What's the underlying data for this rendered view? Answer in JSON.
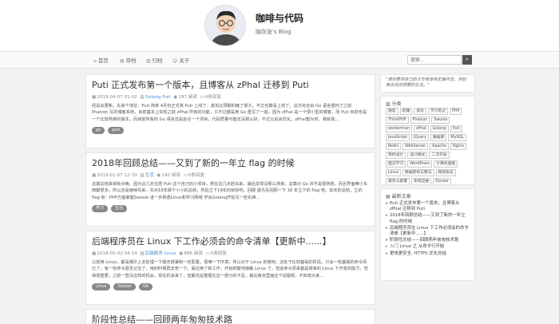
{
  "site": {
    "title": "咖啡与代码",
    "subtitle": "咖灰张's Blog"
  },
  "nav": {
    "items": [
      {
        "icon": "home-icon",
        "glyph": "⌂",
        "label": "首页"
      },
      {
        "icon": "archive-icon",
        "glyph": "▤",
        "label": "存档"
      },
      {
        "icon": "folder-icon",
        "glyph": "▥",
        "label": "归档"
      },
      {
        "icon": "user-icon",
        "glyph": "☺",
        "label": "关于"
      }
    ]
  },
  "search": {
    "placeholder": "搜索...",
    "button_glyph": "⌕"
  },
  "posts": [
    {
      "title": "Puti 正式发布第一个版本，且博客从 zPhal 迁移到 Puti",
      "date": "2019-04-07 01:02",
      "category": "Golang Puti",
      "views": "197 阅读",
      "comments": "0条回复",
      "excerpt": "经是会更新。先来个地址：Puti 简单 4月份正式将 Puti 上线了，其实比预期的晚了很久，不过也算是上线了。这次完全由 Go 语言重构了之前 Phalcon 写的博客系统，目前基本上实现之前 zPhal 所有的功能，只不过都是用 Go 重写了一遍。因为 zPhal 是一个很小型的博客，而 Puti 目前也是一个比较简单的版本，而目前所有的 Go 语言还是处在一个项目，代码质量可能还没那么好，不过以后会优化。zPhal暂为时，我就我...",
      "tags": [
        "go",
        "puti"
      ]
    },
    {
      "title": "2018年回顾总结——又到了新的一年立 flag 的时候",
      "date": "2019-01-07 12:33",
      "category": "生活",
      "views": "190 阅读",
      "comments": "0条回复",
      "excerpt": "这篇总结来得有点晚，因为这几天在把 Puti 这个自己的小项目，想在这几天赶出来，最后发现没那么简单。总算对 Go 并不是很熟悉，而且界面等小东西都很多。所以还是继续先来，先对18年做个小小的总结，然后立下19年的目标吧。回顾 首先先回顾一下 18 年立下的 flag 吧。去年的总结，立的 flag 有：PHP方面掌握Swoole 进一步熟悉Linux和学习网络 学会Golang开始写一些东西...",
      "tags": [
        "学习",
        "生活"
      ]
    },
    {
      "title": "后端程序员在 Linux 下工作必须会的命令清单【更新中......】",
      "date": "2018-05-02 04:14",
      "category": "后端服务 Linux",
      "views": "886 阅读",
      "comments": "0条回复",
      "excerpt": "以前用 Linux，都是偶尔上去处理一下服务部署和一些配置，很难一下环境，所以对于 Linux 的使用，还处于比较基础的阶段。只会一些基础的命令而已了。有一些命令甚至记住了，用的时候再去查一下。最近换了新工作，开始频繁地接触 Linux 了，但该命令原来都是简单的 Linux 下开发的能力，觉得很重要，之前一直没这样的机会，现在机会来了，但最也是整理在这一部分的不足，最近南京里面这个话题呢，不知道大家...",
      "tags": [
        "Linux",
        "Docker",
        "Git"
      ]
    },
    {
      "title": "阶段性总结——回顾两年匆匆技术路",
      "date": "",
      "category": "",
      "views": "",
      "comments": "",
      "excerpt": "",
      "tags": []
    }
  ],
  "sidebar": {
    "quote": "\"请你要将自己的才华修炼到无懈可击，然后再去找你想要的生活。\"",
    "tag_cloud": {
      "title": "分类",
      "tags": [
        "随笔",
        "前端",
        "资讯",
        "学习笔记",
        "PHP",
        "ThinkPHP",
        "Phalcon",
        "Swoole",
        "workerman",
        "zPhal",
        "Golang",
        "Puti",
        "JavaScript",
        "jQuery",
        "数据库",
        "MySQL",
        "Redis",
        "WebServer",
        "Apache",
        "Nginx",
        "架构设计",
        "设计模式",
        "二次开发",
        "面试学习",
        "WordPress",
        "计算机基础",
        "Linux",
        "数据结构与算法",
        "网络协议",
        "服务与部署",
        "系统运维",
        "Docker",
        "开发工具",
        "Git"
      ]
    },
    "recent": {
      "title": "最新文章",
      "items": [
        "Puti 正式发布第一个版本，且博客从 zPhal 迁移到 Puti",
        "2018年回顾总结——又到了新的一年立 flag 的时候",
        "后端程序员在 Linux 下工作必须会的命令清单【更新中......】",
        "阶段性总结——回顾两年匆匆技术路",
        "入门 Linux 之 从命令行开始",
        "更快更安全, HTTPS 优化总结"
      ]
    }
  },
  "colors": {
    "page_bg": "#f2f2f2",
    "card_bg": "#ffffff",
    "tag_bg": "#888888",
    "link": "#4c8fd6"
  }
}
